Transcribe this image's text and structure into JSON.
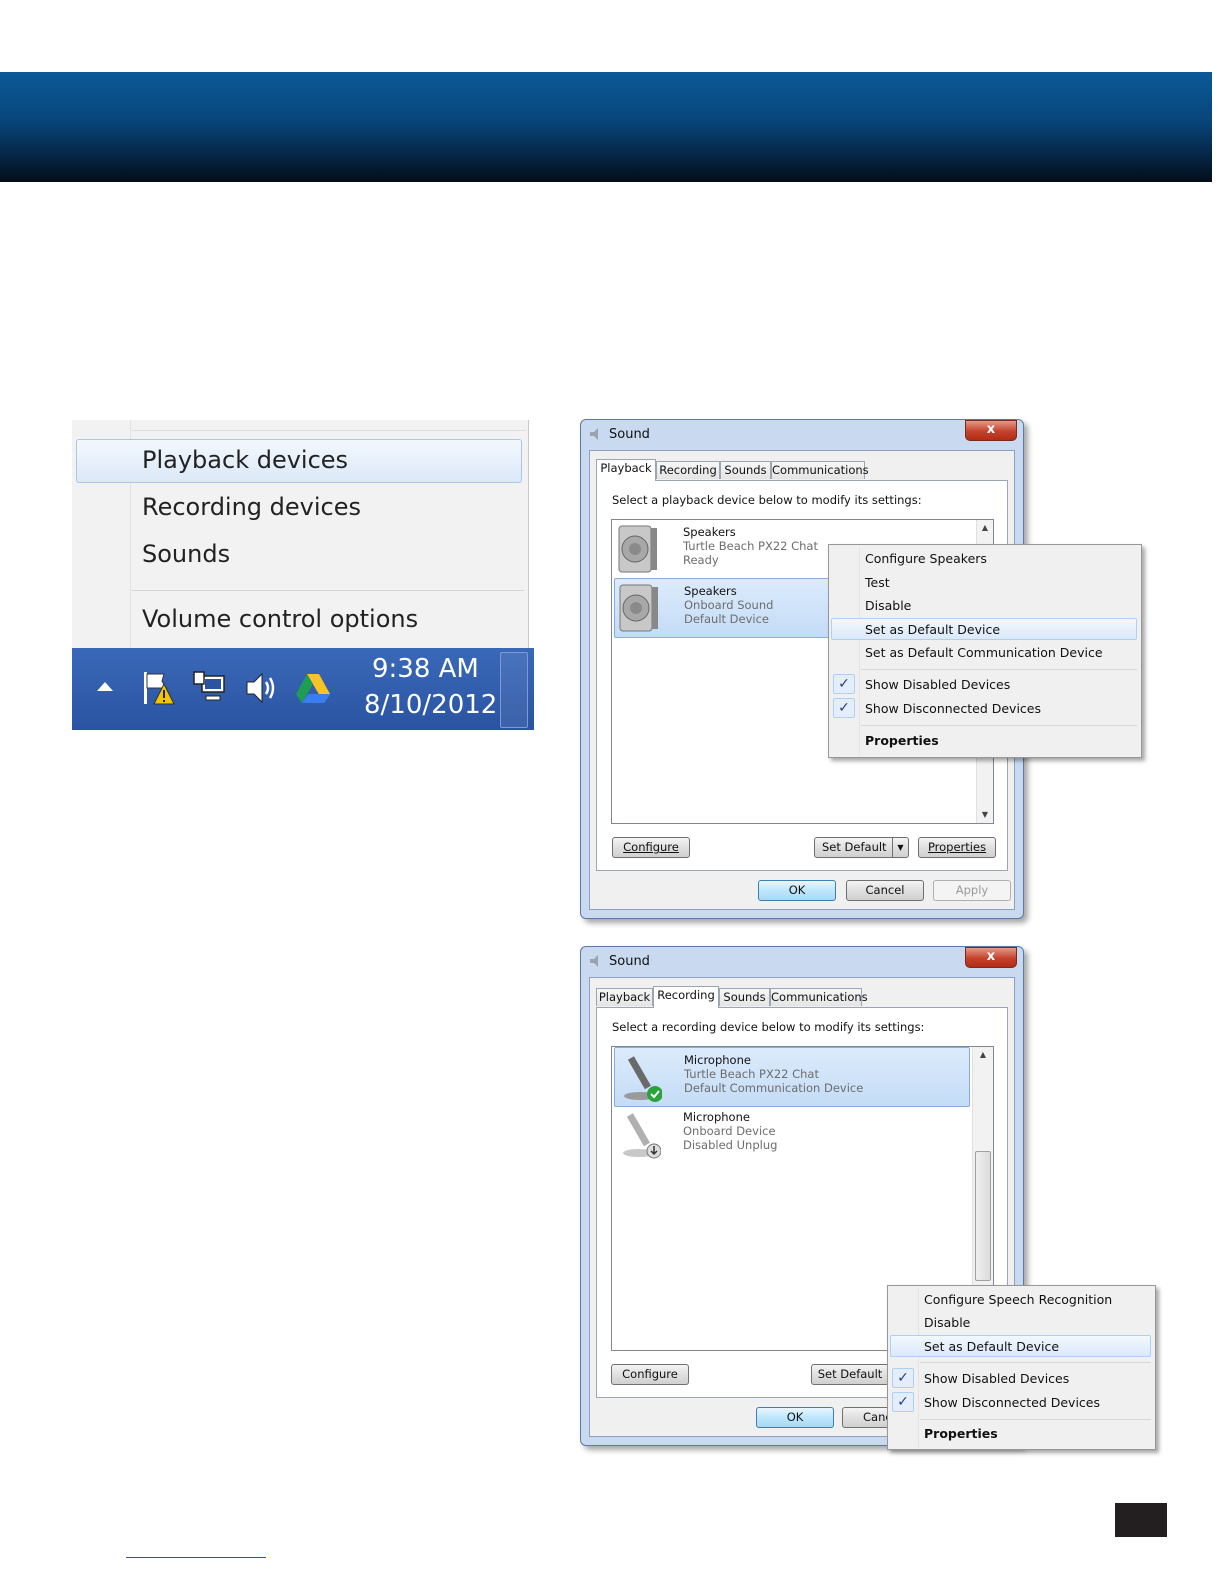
{
  "tray_menu": {
    "items": [
      "Playback devices",
      "Recording devices",
      "Sounds",
      "Volume control options"
    ],
    "time": "9:38 AM",
    "date": "8/10/2012",
    "icons": [
      "show-hidden-icons-arrow",
      "action-center-flag-icon",
      "network-icon",
      "volume-icon",
      "google-drive-icon"
    ]
  },
  "playback_dialog": {
    "title": "Sound",
    "close": "x",
    "tabs": [
      "Playback",
      "Recording",
      "Sounds",
      "Communications"
    ],
    "instruction": "Select a playback device below to modify its settings:",
    "devices": [
      {
        "name": "Speakers",
        "line1": "Turtle Beach PX22 Chat",
        "line2": "Ready"
      },
      {
        "name": "Speakers",
        "line1": "Onboard Sound",
        "line2": "Default Device"
      }
    ],
    "buttons": {
      "configure": "Configure",
      "set_default": "Set Default",
      "properties": "Properties",
      "ok": "OK",
      "cancel": "Cancel",
      "apply": "Apply"
    },
    "context_menu": [
      "Configure Speakers",
      "Test",
      "Disable",
      "Set as Default Device",
      "Set as Default Communication Device",
      "Show Disabled Devices",
      "Show Disconnected Devices",
      "Properties"
    ]
  },
  "recording_dialog": {
    "title": "Sound",
    "close": "x",
    "tabs": [
      "Playback",
      "Recording",
      "Sounds",
      "Communications"
    ],
    "instruction": "Select a recording device below to modify its settings:",
    "devices": [
      {
        "name": "Microphone",
        "line1": "Turtle Beach PX22 Chat",
        "line2": "Default Communication Device"
      },
      {
        "name": "Microphone",
        "line1": "Onboard Device",
        "line2": "Disabled Unplug"
      }
    ],
    "buttons": {
      "configure": "Configure",
      "set_default": "Set Default",
      "ok": "OK",
      "cancel": "Canc"
    },
    "context_menu": [
      "Configure Speech Recognition",
      "Disable",
      "Set as Default Device",
      "Show Disabled Devices",
      "Show Disconnected Devices",
      "Properties"
    ]
  },
  "colors": {
    "banner": "#08457a",
    "taskbar": "#2f5aa8",
    "selection": "#c4dcf6"
  }
}
